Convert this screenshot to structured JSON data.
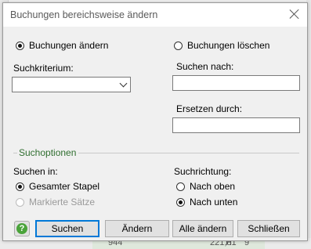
{
  "dialog": {
    "title": "Buchungen bereichsweise ändern"
  },
  "mode": {
    "change_label": "Buchungen ändern",
    "delete_label": "Buchungen löschen",
    "selected": "change"
  },
  "search": {
    "criterion_label": "Suchkriterium:",
    "criterion_value": "",
    "search_for_label": "Suchen nach:",
    "search_for_value": "",
    "replace_with_label": "Ersetzen durch:",
    "replace_with_value": ""
  },
  "options": {
    "group_title": "Suchoptionen",
    "search_in_label": "Suchen in:",
    "entire_batch_label": "Gesamter Stapel",
    "marked_records_label": "Markierte Sätze",
    "direction_label": "Suchrichtung:",
    "up_label": "Nach oben",
    "down_label": "Nach unten",
    "search_in_selected": "entire",
    "direction_selected": "down"
  },
  "buttons": {
    "help_glyph": "?",
    "search_label": "Suchen",
    "change_label": "Ändern",
    "change_all_label": "Alle ändern",
    "close_label": "Schließen"
  },
  "background": {
    "row_number": "944",
    "amount": "221,81",
    "code": "H",
    "digit": "9"
  },
  "colors": {
    "group_title": "#2f6e2f",
    "default_button_border": "#0078d7",
    "help_icon": "#4aa33a"
  }
}
